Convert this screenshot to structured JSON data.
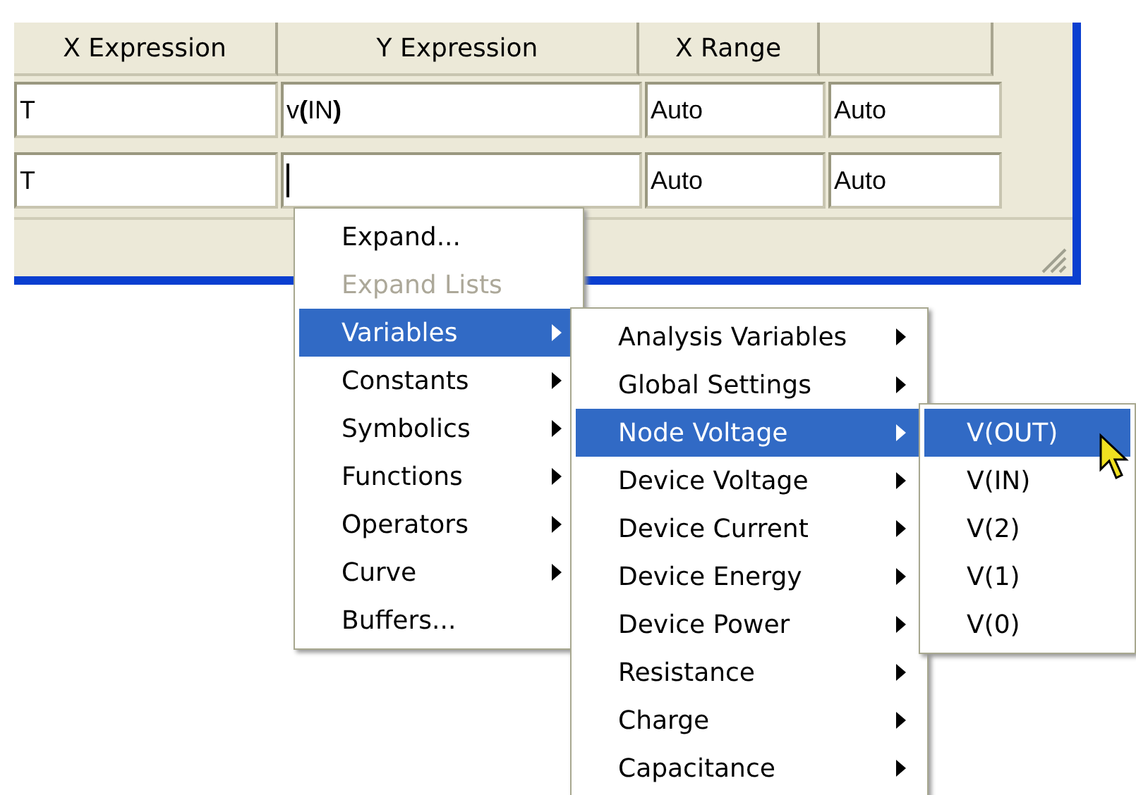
{
  "table": {
    "columns": [
      {
        "label": "X Expression"
      },
      {
        "label": "Y Expression"
      },
      {
        "label": "X Range"
      }
    ],
    "rows": [
      {
        "cells": [
          {
            "value": "T",
            "focused": false
          },
          {
            "value": "v**(**IN**)**",
            "focused": false
          },
          {
            "value": "Auto",
            "focused": false
          },
          {
            "value": "Auto",
            "focused": false
          }
        ]
      },
      {
        "cells": [
          {
            "value": "T",
            "focused": false
          },
          {
            "focused": true
          },
          {
            "value": "Auto",
            "focused": false
          },
          {
            "value": "Auto",
            "focused": false
          }
        ]
      }
    ]
  },
  "menus": [
    {
      "items": [
        {
          "label": "Expand...",
          "submenu": false,
          "disabled": false,
          "selected": false
        },
        {
          "label": "Expand Lists",
          "submenu": false,
          "disabled": true,
          "selected": false
        },
        {
          "label": "Variables",
          "submenu": true,
          "disabled": false,
          "selected": true
        },
        {
          "label": "Constants",
          "submenu": true,
          "disabled": false,
          "selected": false
        },
        {
          "label": "Symbolics",
          "submenu": true,
          "disabled": false,
          "selected": false
        },
        {
          "label": "Functions",
          "submenu": true,
          "disabled": false,
          "selected": false
        },
        {
          "label": "Operators",
          "submenu": true,
          "disabled": false,
          "selected": false
        },
        {
          "label": "Curve",
          "submenu": true,
          "disabled": false,
          "selected": false
        },
        {
          "label": "Buffers...",
          "submenu": false,
          "disabled": false,
          "selected": false
        }
      ]
    },
    {
      "items": [
        {
          "label": "Analysis Variables",
          "submenu": true,
          "disabled": false,
          "selected": false
        },
        {
          "label": "Global Settings",
          "submenu": true,
          "disabled": false,
          "selected": false
        },
        {
          "label": "Node Voltage",
          "submenu": true,
          "disabled": false,
          "selected": true
        },
        {
          "label": "Device Voltage",
          "submenu": true,
          "disabled": false,
          "selected": false
        },
        {
          "label": "Device Current",
          "submenu": true,
          "disabled": false,
          "selected": false
        },
        {
          "label": "Device Energy",
          "submenu": true,
          "disabled": false,
          "selected": false
        },
        {
          "label": "Device Power",
          "submenu": true,
          "disabled": false,
          "selected": false
        },
        {
          "label": "Resistance",
          "submenu": true,
          "disabled": false,
          "selected": false
        },
        {
          "label": "Charge",
          "submenu": true,
          "disabled": false,
          "selected": false
        },
        {
          "label": "Capacitance",
          "submenu": true,
          "disabled": false,
          "selected": false
        }
      ]
    },
    {
      "items": [
        {
          "label": "V(OUT)",
          "submenu": false,
          "disabled": false,
          "selected": true
        },
        {
          "label": "V(IN)",
          "submenu": false,
          "disabled": false,
          "selected": false
        },
        {
          "label": "V(2)",
          "submenu": false,
          "disabled": false,
          "selected": false
        },
        {
          "label": "V(1)",
          "submenu": false,
          "disabled": false,
          "selected": false
        },
        {
          "label": "V(0)",
          "submenu": false,
          "disabled": false,
          "selected": false
        }
      ]
    }
  ]
}
